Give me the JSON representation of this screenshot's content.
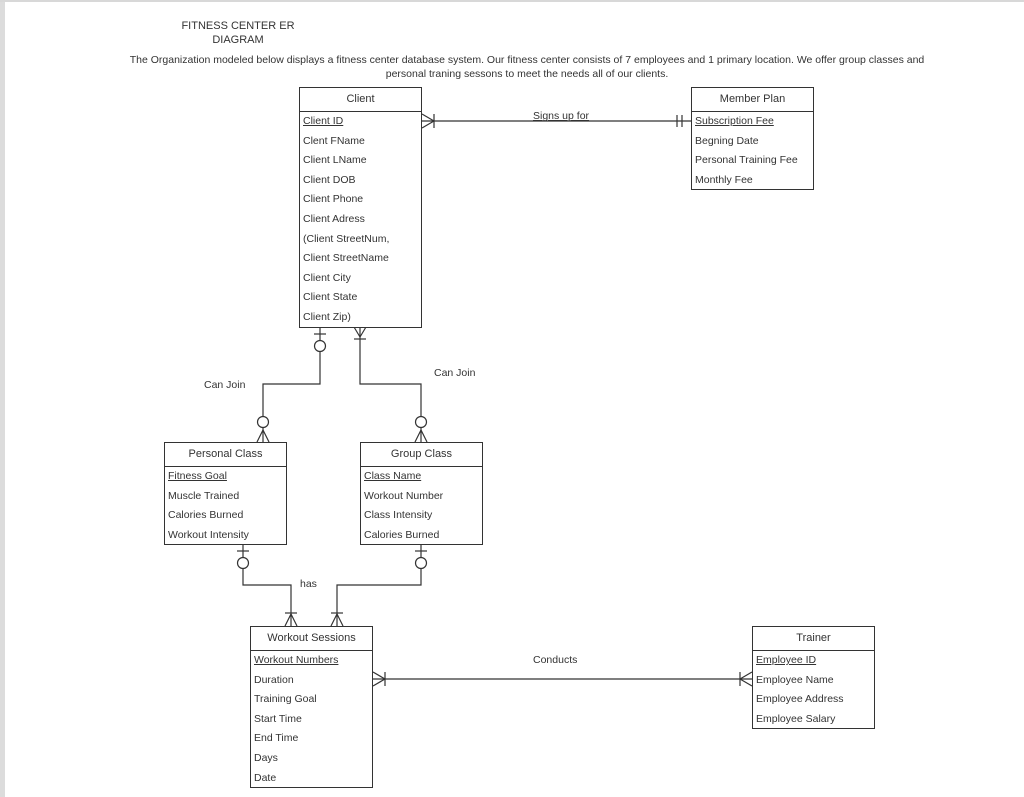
{
  "title": "FITNESS CENTER ER DIAGRAM",
  "title_lines": [
    "FITNESS CENTER ER",
    "DIAGRAM"
  ],
  "description": "The Organization modeled below displays a fitness center database system. Our fitness center consists of 7 employees and 1 primary location. We offer group classes and personal traning sessons to meet the needs all of our clients.",
  "entities": {
    "client": {
      "name": "Client",
      "primary_key": "Client ID",
      "attributes": [
        "Client ID",
        "Clent FName",
        "Client LName",
        "Client DOB",
        "Client Phone",
        "Client Adress",
        "(Client StreetNum,",
        "Client StreetName",
        "Client City",
        "Client State",
        "Client Zip)"
      ]
    },
    "member_plan": {
      "name": "Member Plan",
      "primary_key": "Subscription Fee",
      "attributes": [
        "Subscription Fee",
        "Begning  Date",
        "Personal Training Fee",
        "Monthly Fee"
      ]
    },
    "personal_class": {
      "name": "Personal Class",
      "primary_key": "Fitness Goal",
      "attributes": [
        "Fitness Goal",
        "Muscle Trained",
        "Calories Burned",
        "Workout Intensity"
      ]
    },
    "group_class": {
      "name": "Group Class",
      "primary_key": "Class Name",
      "attributes": [
        "Class Name",
        "Workout Number",
        "Class Intensity",
        "Calories Burned"
      ]
    },
    "workout_sessions": {
      "name": "Workout Sessions",
      "primary_key": "Workout Numbers",
      "attributes": [
        "Workout Numbers",
        "Duration",
        "Training Goal",
        "Start Time",
        "End Time",
        "Days",
        "Date"
      ]
    },
    "trainer": {
      "name": "Trainer",
      "primary_key": "Employee ID",
      "attributes": [
        "Employee ID",
        "Employee Name",
        "Employee Address",
        "Employee Salary"
      ]
    }
  },
  "relationships": [
    {
      "label": "Signs up for",
      "from": "Client",
      "from_cardinality": "one-or-many",
      "to": "Member Plan",
      "to_cardinality": "one-and-only-one"
    },
    {
      "label": "Can Join",
      "from": "Client",
      "from_cardinality": "zero-or-one",
      "to": "Personal Class",
      "to_cardinality": "zero-or-many"
    },
    {
      "label": "Can Join",
      "from": "Client",
      "from_cardinality": "one-or-many",
      "to": "Group Class",
      "to_cardinality": "zero-or-many"
    },
    {
      "label": "has",
      "from": "Personal Class",
      "from_cardinality": "zero-or-one",
      "to": "Workout Sessions",
      "to_cardinality": "one-or-many"
    },
    {
      "label": "has",
      "from": "Group Class",
      "from_cardinality": "zero-or-one",
      "to": "Workout Sessions",
      "to_cardinality": "one-or-many"
    },
    {
      "label": "Conducts",
      "from": "Workout Sessions",
      "from_cardinality": "one-or-many",
      "to": "Trainer",
      "to_cardinality": "one-or-many"
    }
  ],
  "relationship_labels": {
    "signs_up_for": "Signs up for",
    "can_join_personal": "Can Join",
    "can_join_group": "Can Join",
    "has": "has",
    "conducts": "Conducts"
  }
}
